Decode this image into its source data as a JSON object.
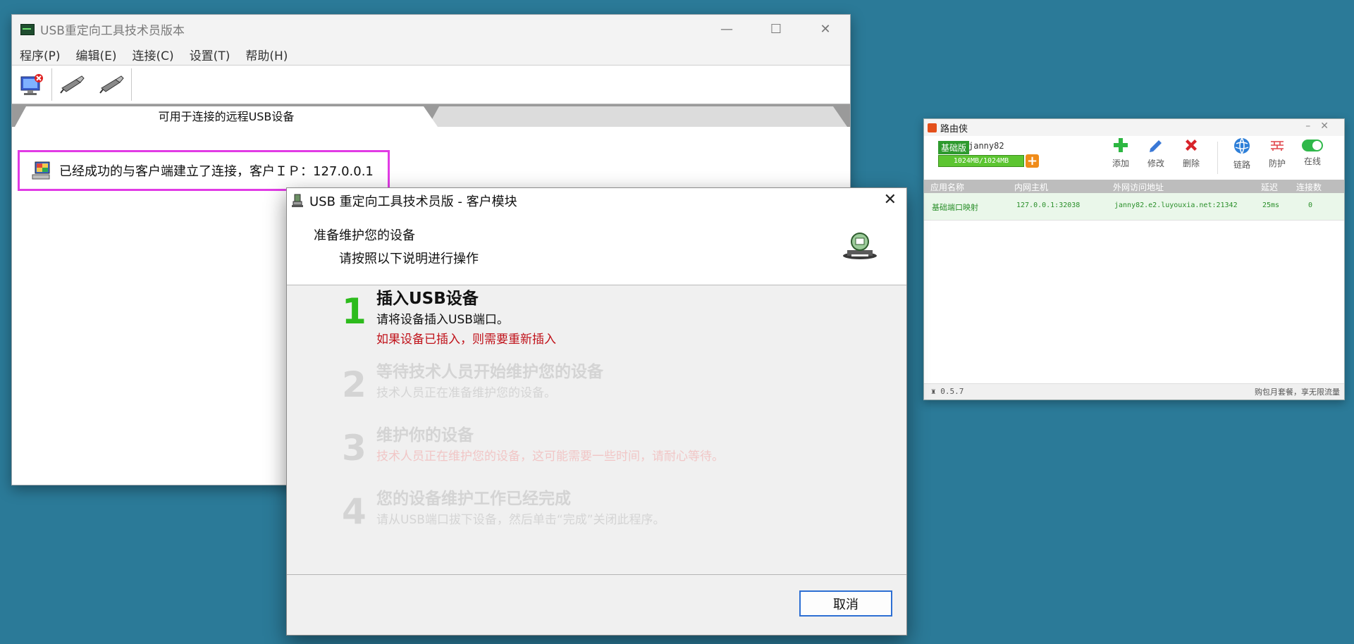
{
  "main_window": {
    "title": "USB重定向工具技术员版本",
    "menu": [
      "程序(P)",
      "编辑(E)",
      "连接(C)",
      "设置(T)",
      "帮助(H)"
    ],
    "tab_active": "可用于连接的远程USB设备",
    "connection_text": "已经成功的与客户端建立了连接，客户ＩＰ：127.0.0.1"
  },
  "dialog": {
    "title": "USB 重定向工具技术员版 - 客户模块",
    "header_title": "准备维护您的设备",
    "header_subtitle": "请按照以下说明进行操作",
    "steps": [
      {
        "num": "1",
        "title": "插入USB设备",
        "desc": "请将设备插入USB端口。",
        "warn": "如果设备已插入，则需要重新插入"
      },
      {
        "num": "2",
        "title": "等待技术人员开始维护您的设备",
        "desc": "技术人员正在准备维护您的设备。"
      },
      {
        "num": "3",
        "title": "维护你的设备",
        "desc": "技术人员正在维护您的设备，这可能需要一些时间，请耐心等待。"
      },
      {
        "num": "4",
        "title": "您的设备维护工作已经完成",
        "desc": "请从USB端口拔下设备，然后单击“完成”关闭此程序。"
      }
    ],
    "cancel_label": "取消",
    "colors": {
      "active_step": "#2dbb1c",
      "warn": "#c0121a",
      "disabled": "#d4d4d4",
      "disabled_warn": "#f3c9c9"
    }
  },
  "router": {
    "title": "路由侠",
    "badge": "基础版",
    "username": "janny82",
    "quota": "1024MB/1024MB",
    "buttons": [
      "添加",
      "修改",
      "删除",
      "链路",
      "防护",
      "在线"
    ],
    "columns": [
      "应用名称",
      "内网主机",
      "外网访问地址",
      "延迟",
      "连接数"
    ],
    "rows": [
      {
        "name": "基础端口映射",
        "host": "127.0.0.1:32038",
        "addr": "janny82.e2.luyouxia.net:21342",
        "latency": "25ms",
        "conns": "0"
      }
    ],
    "version": "0.5.7",
    "promo": "购包月套餐，享无限流量"
  }
}
